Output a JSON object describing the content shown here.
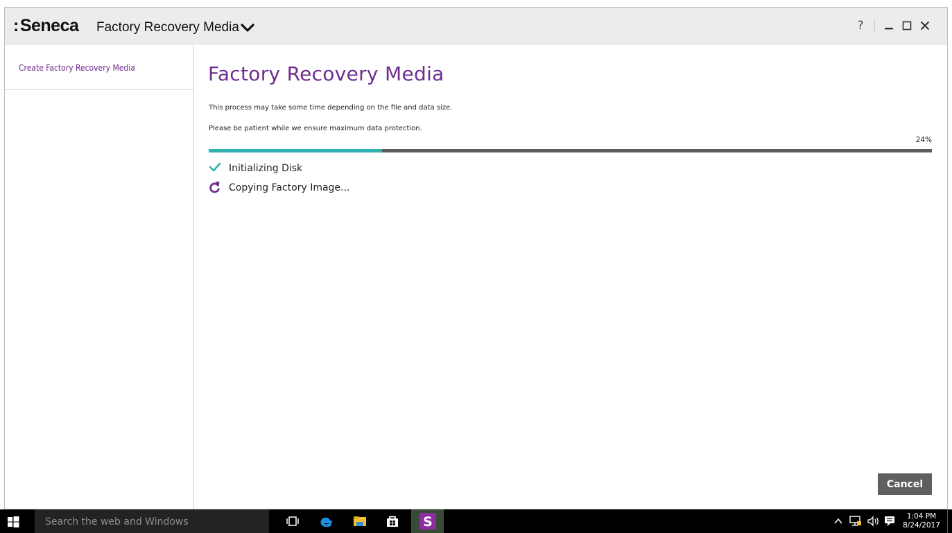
{
  "app": {
    "brand": "Seneca",
    "brand_prefix": ":",
    "name": "Factory Recovery Media"
  },
  "window_controls": {
    "help": "?",
    "minimize": "—",
    "maximize": "□",
    "close": "✕"
  },
  "sidebar": {
    "items": [
      {
        "label": "Create Factory Recovery Media"
      }
    ]
  },
  "main": {
    "title": "Factory Recovery Media",
    "description_1": "This process may take some time depending on the file and data size.",
    "description_2": "Please be patient while we ensure maximum data protection.",
    "progress_label": "24%",
    "progress_fraction": 0.24,
    "steps": [
      {
        "label": "Initializing Disk",
        "icon": "check-icon",
        "status": "done"
      },
      {
        "label": "Copying Factory Image...",
        "icon": "refresh-icon",
        "status": "in-progress"
      }
    ],
    "cancel_label": "Cancel"
  },
  "colors": {
    "accent": "#6f2c91",
    "progress_fill": "#2fb0b0",
    "progress_track": "#5d5d5d",
    "check": "#2fb0b0"
  },
  "taskbar": {
    "search_placeholder": "Search the web and Windows",
    "time": "1:04 PM",
    "date": "8/24/2017",
    "pinned": [
      "task-view-icon",
      "edge-icon",
      "file-explorer-icon",
      "store-icon",
      "seneca-app-icon"
    ],
    "tray": [
      "chevron-up-icon",
      "network-icon",
      "volume-icon",
      "action-center-icon"
    ]
  }
}
